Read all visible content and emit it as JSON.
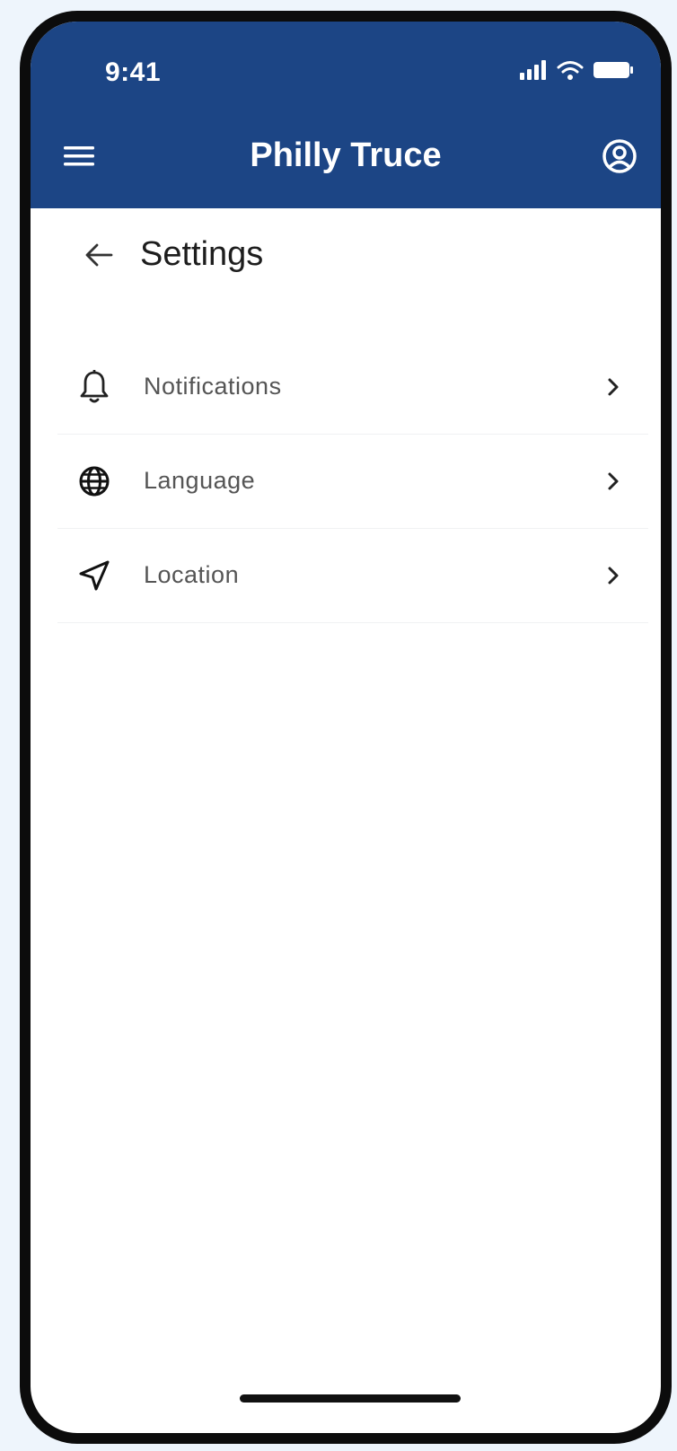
{
  "status_bar": {
    "time": "9:41"
  },
  "app_bar": {
    "title": "Philly Truce",
    "background_color": "#1c4585",
    "menu_icon": "menu-icon",
    "profile_icon": "account-circle-icon"
  },
  "page": {
    "title": "Settings",
    "back_icon": "arrow-left-icon"
  },
  "settings": {
    "items": [
      {
        "label": "Notifications",
        "icon": "bell-icon"
      },
      {
        "label": "Language",
        "icon": "globe-icon"
      },
      {
        "label": "Location",
        "icon": "navigation-arrow-icon"
      }
    ]
  }
}
